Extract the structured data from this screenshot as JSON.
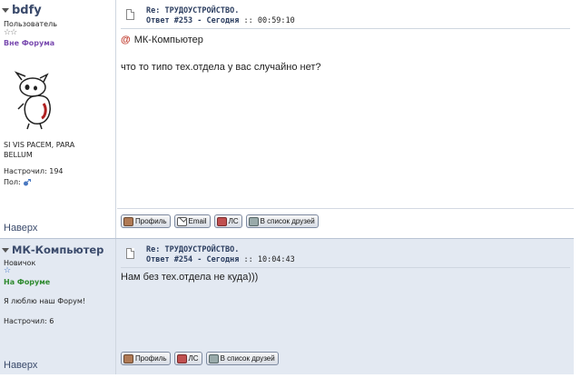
{
  "posts": [
    {
      "author": "bdfy",
      "rank": "Пользователь",
      "stars": "☆☆",
      "status": "Вне Форума",
      "signature": "SI VIS PACEM, PARA BELLUM",
      "posts_label": "Настрочил:",
      "posts_count": "194",
      "gender_label": "Пол:",
      "top_link": "Наверх",
      "title": "Re: ТРУДОУСТРОЙСТВО.",
      "reply_no": "Ответ #253 - Сегодня",
      "time": ":: 00:59:10",
      "quote_author": "МК-Компьютер",
      "message": "что то типо тех.отдела у вас случайно нет?",
      "buttons": [
        "Профиль",
        "Email",
        "ЛС",
        "В список друзей"
      ]
    },
    {
      "author": "МК-Компьютер",
      "rank": "Новичок",
      "stars": "☆",
      "status": "На Форуме",
      "signature": "Я люблю наш Форум!",
      "posts_label": "Настрочил:",
      "posts_count": "6",
      "top_link": "Наверх",
      "title": "Re: ТРУДОУСТРОЙСТВО.",
      "reply_no": "Ответ #254 - Сегодня",
      "time": ":: 10:04:43",
      "message": "Нам без тех.отдела не куда)))",
      "buttons": [
        "Профиль",
        "ЛС",
        "В список друзей"
      ]
    }
  ],
  "colors": {
    "author": "#3a4a6b",
    "offline": "#7a4bb0",
    "online": "#2f8a2f",
    "quote_marker": "#c0392b",
    "post2_bg": "#e3e9f2"
  },
  "icons": {
    "collapse": "chevron-down-icon",
    "post": "document-icon",
    "quote": "at-icon",
    "gender": "male-gender-icon",
    "stars": "star-icon",
    "profile": "profile-icon",
    "email": "envelope-icon",
    "pm": "pm-icon",
    "friends": "friends-icon"
  }
}
